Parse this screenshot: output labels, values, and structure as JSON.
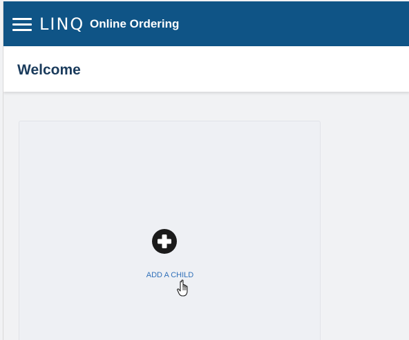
{
  "header": {
    "brand": "LINQ",
    "product": "Online Ordering",
    "menu_icon": "hamburger-menu-icon",
    "color": "#0f5486"
  },
  "page": {
    "title": "Welcome"
  },
  "card": {
    "action_label": "ADD A CHILD",
    "action_icon": "plus-circle-icon",
    "accent": "#2f6fb8"
  },
  "pointer": {
    "icon": "hand-pointer-cursor-icon"
  }
}
